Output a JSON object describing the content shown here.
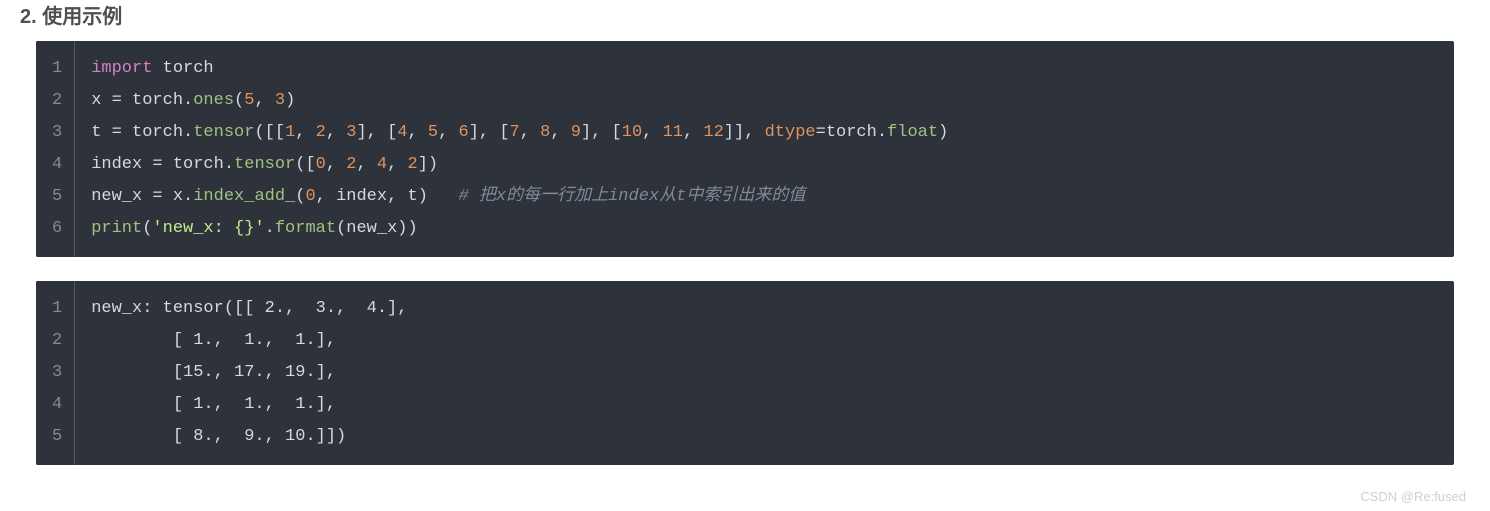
{
  "heading": "2. 使用示例",
  "watermark": "CSDN @Re:fused",
  "block1": {
    "lineNumbers": [
      "1",
      "2",
      "3",
      "4",
      "5",
      "6"
    ],
    "lines": [
      [
        {
          "t": "import",
          "c": "kw"
        },
        {
          "t": " ",
          "c": "ident"
        },
        {
          "t": "torch",
          "c": "ident"
        }
      ],
      [
        {
          "t": "x ",
          "c": "ident"
        },
        {
          "t": "=",
          "c": "punct"
        },
        {
          "t": " torch.",
          "c": "ident"
        },
        {
          "t": "ones",
          "c": "func"
        },
        {
          "t": "(",
          "c": "punct"
        },
        {
          "t": "5",
          "c": "num"
        },
        {
          "t": ", ",
          "c": "punct"
        },
        {
          "t": "3",
          "c": "num"
        },
        {
          "t": ")",
          "c": "punct"
        }
      ],
      [
        {
          "t": "t ",
          "c": "ident"
        },
        {
          "t": "=",
          "c": "punct"
        },
        {
          "t": " torch.",
          "c": "ident"
        },
        {
          "t": "tensor",
          "c": "func"
        },
        {
          "t": "([[",
          "c": "punct"
        },
        {
          "t": "1",
          "c": "num"
        },
        {
          "t": ", ",
          "c": "punct"
        },
        {
          "t": "2",
          "c": "num"
        },
        {
          "t": ", ",
          "c": "punct"
        },
        {
          "t": "3",
          "c": "num"
        },
        {
          "t": "], [",
          "c": "punct"
        },
        {
          "t": "4",
          "c": "num"
        },
        {
          "t": ", ",
          "c": "punct"
        },
        {
          "t": "5",
          "c": "num"
        },
        {
          "t": ", ",
          "c": "punct"
        },
        {
          "t": "6",
          "c": "num"
        },
        {
          "t": "], [",
          "c": "punct"
        },
        {
          "t": "7",
          "c": "num"
        },
        {
          "t": ", ",
          "c": "punct"
        },
        {
          "t": "8",
          "c": "num"
        },
        {
          "t": ", ",
          "c": "punct"
        },
        {
          "t": "9",
          "c": "num"
        },
        {
          "t": "], [",
          "c": "punct"
        },
        {
          "t": "10",
          "c": "num"
        },
        {
          "t": ", ",
          "c": "punct"
        },
        {
          "t": "11",
          "c": "num"
        },
        {
          "t": ", ",
          "c": "punct"
        },
        {
          "t": "12",
          "c": "num"
        },
        {
          "t": "]], ",
          "c": "punct"
        },
        {
          "t": "dtype",
          "c": "param"
        },
        {
          "t": "=",
          "c": "punct"
        },
        {
          "t": "torch.",
          "c": "ident"
        },
        {
          "t": "float",
          "c": "func"
        },
        {
          "t": ")",
          "c": "punct"
        }
      ],
      [
        {
          "t": "index ",
          "c": "ident"
        },
        {
          "t": "=",
          "c": "punct"
        },
        {
          "t": " torch.",
          "c": "ident"
        },
        {
          "t": "tensor",
          "c": "func"
        },
        {
          "t": "([",
          "c": "punct"
        },
        {
          "t": "0",
          "c": "num"
        },
        {
          "t": ", ",
          "c": "punct"
        },
        {
          "t": "2",
          "c": "num"
        },
        {
          "t": ", ",
          "c": "punct"
        },
        {
          "t": "4",
          "c": "num"
        },
        {
          "t": ", ",
          "c": "punct"
        },
        {
          "t": "2",
          "c": "num"
        },
        {
          "t": "])",
          "c": "punct"
        }
      ],
      [
        {
          "t": "new_x ",
          "c": "ident"
        },
        {
          "t": "=",
          "c": "punct"
        },
        {
          "t": " x.",
          "c": "ident"
        },
        {
          "t": "index_add_",
          "c": "func"
        },
        {
          "t": "(",
          "c": "punct"
        },
        {
          "t": "0",
          "c": "num"
        },
        {
          "t": ", index, t)   ",
          "c": "ident"
        },
        {
          "t": "# 把x的每一行加上index从t中索引出来的值",
          "c": "comment"
        }
      ],
      [
        {
          "t": "print",
          "c": "func"
        },
        {
          "t": "(",
          "c": "punct"
        },
        {
          "t": "'new_x: {}'",
          "c": "str"
        },
        {
          "t": ".",
          "c": "punct"
        },
        {
          "t": "format",
          "c": "func"
        },
        {
          "t": "(new_x))",
          "c": "punct"
        }
      ]
    ]
  },
  "block2": {
    "lineNumbers": [
      "1",
      "2",
      "3",
      "4",
      "5"
    ],
    "lines": [
      [
        {
          "t": "new_x: tensor([[ 2.,  3.,  4.],",
          "c": "ident"
        }
      ],
      [
        {
          "t": "        [ 1.,  1.,  1.],",
          "c": "ident"
        }
      ],
      [
        {
          "t": "        [15., 17., 19.],",
          "c": "ident"
        }
      ],
      [
        {
          "t": "        [ 1.,  1.,  1.],",
          "c": "ident"
        }
      ],
      [
        {
          "t": "        [ 8.,  9., 10.]])",
          "c": "ident"
        }
      ]
    ]
  }
}
